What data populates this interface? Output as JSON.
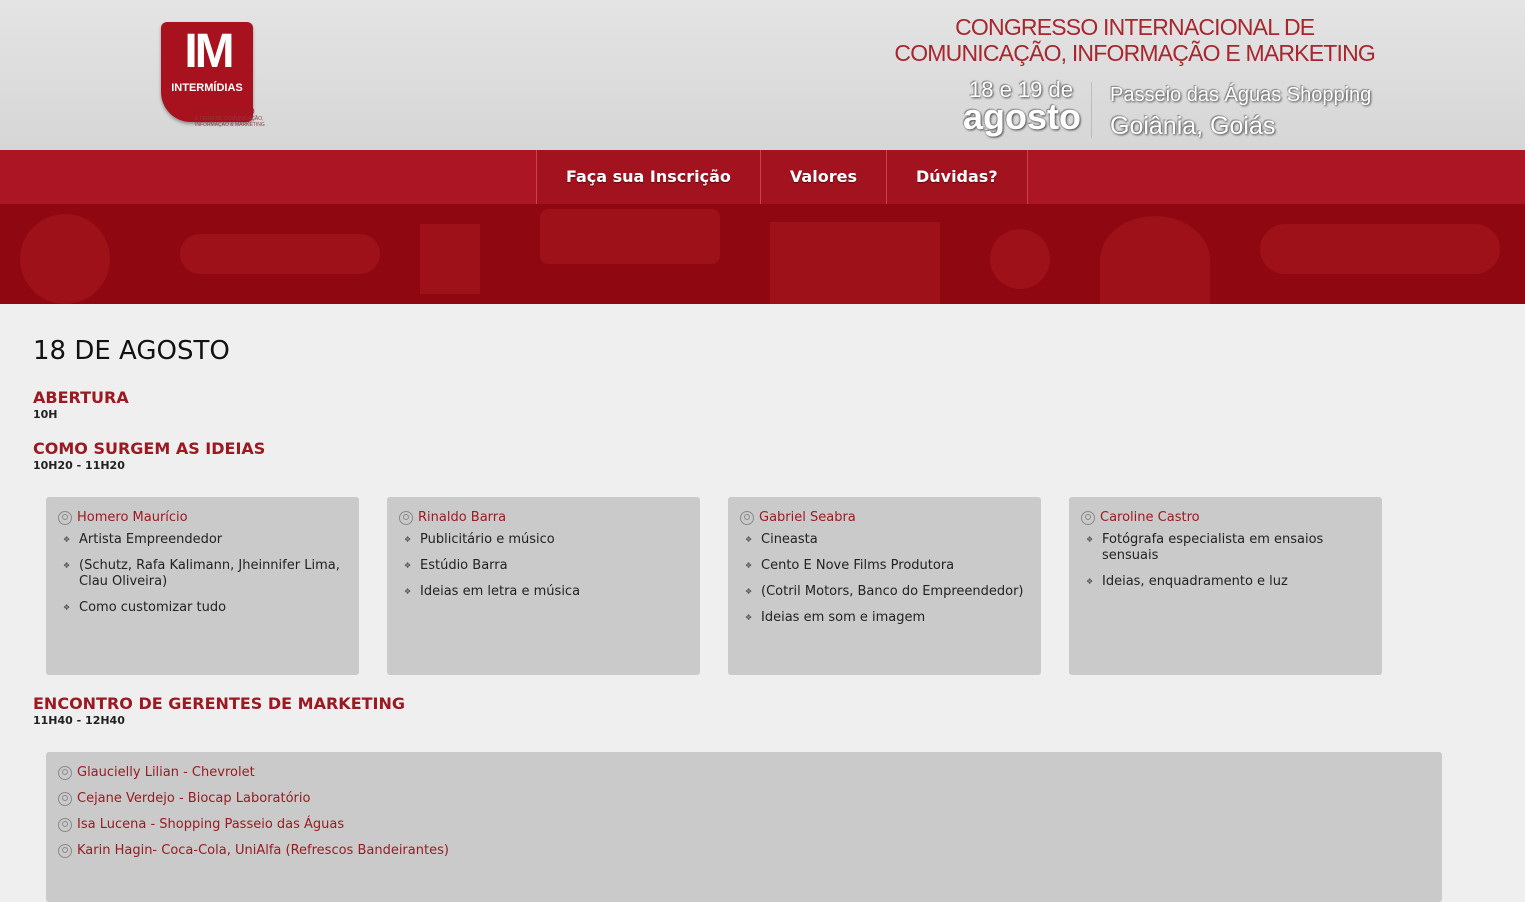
{
  "header": {
    "logo_text": "IM",
    "logo_brand": "INTERMÍDIAS",
    "logo_edition": "7°CONGRESSO",
    "logo_subtitle": "E FEIRA DE COMUNICAÇÃO, INFORMAÇÃO & MARKETING",
    "title_line1": "CONGRESSO INTERNACIONAL DE",
    "title_line2": "COMUNICAÇÃO, INFORMAÇÃO E MARKETING",
    "date_line1": "18 e 19 de",
    "date_line2": "agosto",
    "place_line1": "Passeio das Águas Shopping",
    "place_line2": "Goiânia, Goiás"
  },
  "nav": {
    "items": [
      "Faça sua Inscrição",
      "Valores",
      "Dúvidas?"
    ]
  },
  "day": {
    "title": "18 DE AGOSTO",
    "sections": [
      {
        "title": "ABERTURA",
        "time": "10H"
      },
      {
        "title": "COMO SURGEM AS IDEIAS",
        "time": "10H20 - 11H20",
        "speakers": [
          {
            "name": "Homero Maurício",
            "bullets": [
              "Artista Empreendedor",
              "(Schutz, Rafa Kalimann, Jheinnifer Lima, Clau Oliveira)",
              "Como customizar tudo"
            ]
          },
          {
            "name": "Rinaldo Barra",
            "bullets": [
              "Publicitário e músico",
              "Estúdio Barra",
              "Ideias em letra e música"
            ]
          },
          {
            "name": "Gabriel Seabra",
            "bullets": [
              "Cineasta",
              "Cento E Nove Films Produtora",
              "(Cotril Motors, Banco do Empreendedor)",
              "Ideias em som e imagem"
            ]
          },
          {
            "name": "Caroline Castro",
            "bullets": [
              "Fotógrafa especialista em ensaios sensuais",
              "Ideias, enquadramento e luz"
            ]
          }
        ]
      },
      {
        "title": "ENCONTRO DE GERENTES DE MARKETING",
        "time": "11H40 - 12H40",
        "speakers": [
          "Glaucielly Lilian - Chevrolet",
          "Cejane Verdejo - Biocap Laboratório",
          "Isa Lucena - Shopping Passeio das Águas",
          "Karin Hagin- Coca-Cola, UniAlfa (Refrescos Bandeirantes)"
        ]
      }
    ]
  },
  "colors": {
    "brand_red": "#ac1524",
    "banner_red": "#8f0710",
    "accent_text": "#9b1a22",
    "card_bg": "#cacaca",
    "page_bg": "#efefef"
  },
  "icons": [
    "person-icon",
    "diamond-bullet-icon"
  ]
}
